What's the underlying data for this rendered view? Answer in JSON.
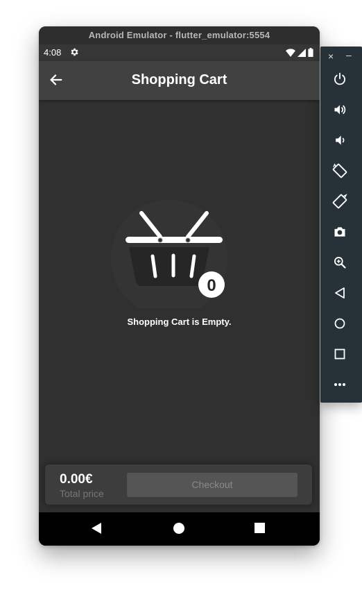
{
  "window": {
    "title": "Android Emulator - flutter_emulator:5554"
  },
  "status_bar": {
    "time": "4:08"
  },
  "app_bar": {
    "title": "Shopping Cart"
  },
  "cart": {
    "badge_count": "0",
    "empty_message": "Shopping Cart is Empty."
  },
  "summary": {
    "total_value": "0.00€",
    "total_label": "Total price",
    "checkout_label": "Checkout"
  },
  "side_toolbar": {
    "close_label": "×",
    "minimize_label": "–",
    "tools": [
      "power-icon",
      "volume-up-icon",
      "volume-down-icon",
      "rotate-left-icon",
      "rotate-right-icon",
      "camera-icon",
      "zoom-icon",
      "back-icon",
      "home-icon",
      "overview-icon",
      "more-icon"
    ]
  },
  "colors": {
    "background": "#303030",
    "app_bar": "#414141",
    "toolbar": "#263238",
    "checkout_disabled": "#555555"
  }
}
